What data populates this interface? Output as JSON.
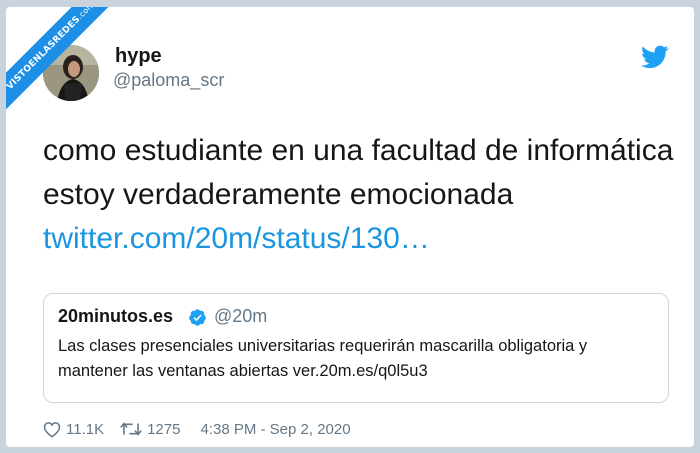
{
  "watermark": {
    "text": "VISTOENLASREDES",
    "suffix": ".com",
    "color": "#1d8fe6"
  },
  "author": {
    "display_name": "hype",
    "handle": "@paloma_scr"
  },
  "tweet": {
    "text": "como estudiante en una facultad de informática estoy verdaderamente emocionada ",
    "link_text": "twitter.com/20m/status/130…",
    "link_color": "#1b95e0"
  },
  "quoted": {
    "name": "20minutos.es",
    "handle": "@20m",
    "text": "Las clases presenciales universitarias requerirán mascarilla obligatoria y mantener las ventanas abiertas ver.20m.es/q0l5u3"
  },
  "meta": {
    "likes": "11.1K",
    "retweets": "1275",
    "timestamp": "4:38 PM - Sep 2, 2020"
  },
  "icons": {
    "logo": "twitter-bird-icon",
    "verified": "verified-badge-icon",
    "like": "heart-icon",
    "retweet": "retweet-icon"
  }
}
